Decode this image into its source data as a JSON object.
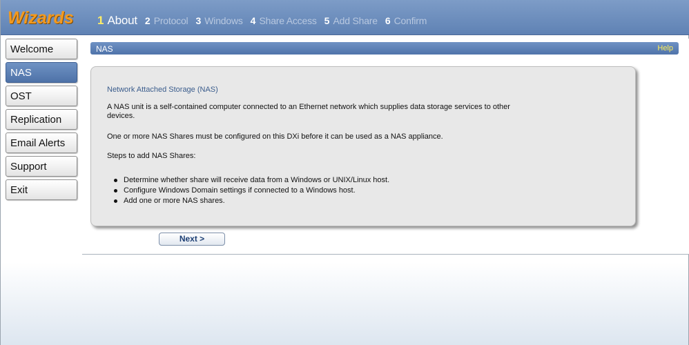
{
  "header": {
    "brand": "Wizards",
    "steps": [
      {
        "num": "1",
        "label": "About"
      },
      {
        "num": "2",
        "label": "Protocol"
      },
      {
        "num": "3",
        "label": "Windows"
      },
      {
        "num": "4",
        "label": "Share Access"
      },
      {
        "num": "5",
        "label": "Add Share"
      },
      {
        "num": "6",
        "label": "Confirm"
      }
    ],
    "active_step": 1
  },
  "sidebar": {
    "items": [
      {
        "label": "Welcome"
      },
      {
        "label": "NAS"
      },
      {
        "label": "OST"
      },
      {
        "label": "Replication"
      },
      {
        "label": "Email Alerts"
      },
      {
        "label": "Support"
      },
      {
        "label": "Exit"
      }
    ],
    "active": "NAS"
  },
  "section": {
    "title": "NAS",
    "help": "Help"
  },
  "panel": {
    "title": "Network Attached Storage (NAS)",
    "p1": "A NAS unit is a self-contained computer connected to an Ethernet network which supplies data storage services to other devices.",
    "p2": "One or more NAS Shares must be configured on this DXi before it can be used as a NAS appliance.",
    "p3": "Steps to add NAS Shares:",
    "bullets": [
      "Determine whether share will receive data from a Windows or UNIX/Linux host.",
      "Configure Windows Domain settings if connected to a Windows host.",
      "Add one or more NAS shares."
    ]
  },
  "next_label": "Next >",
  "colors": {
    "header_blue": "#6a8cbf",
    "brand_orange": "#f39a1f",
    "active_step_yellow": "#ffee66",
    "help_yellow": "#ffee55"
  }
}
